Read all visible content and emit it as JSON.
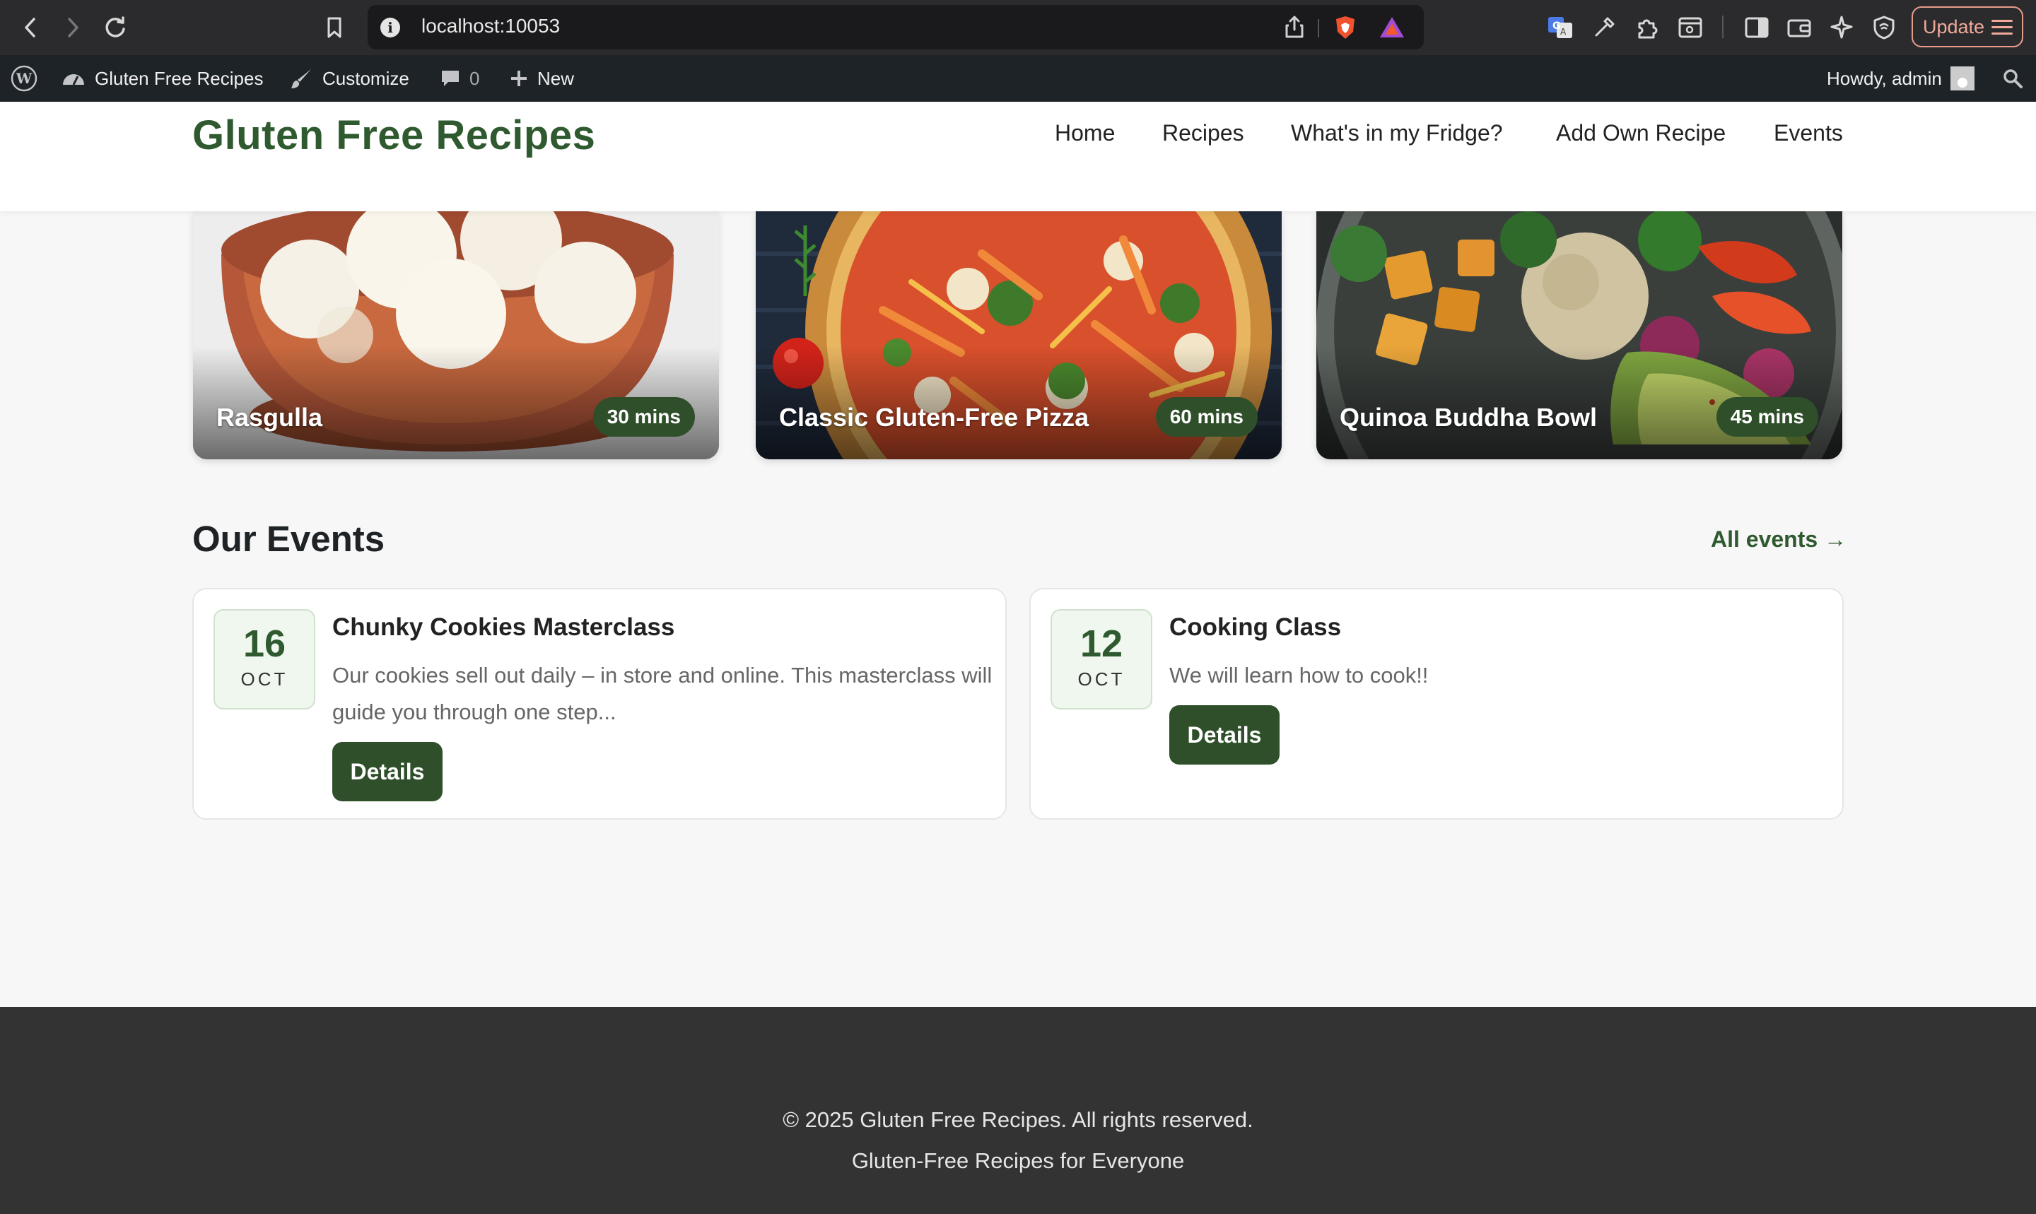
{
  "browser": {
    "url": "localhost:10053",
    "update_label": "Update"
  },
  "adminbar": {
    "site_name": "Gluten Free Recipes",
    "customize": "Customize",
    "comments_count": "0",
    "new_label": "New",
    "howdy": "Howdy, admin"
  },
  "site": {
    "title": "Gluten Free Recipes",
    "nav": [
      "Home",
      "Recipes",
      "What's in my Fridge?",
      "Add Own Recipe",
      "Events"
    ]
  },
  "recipes": [
    {
      "name": "Rasgulla",
      "time": "30 mins"
    },
    {
      "name": "Classic Gluten-Free Pizza",
      "time": "60 mins"
    },
    {
      "name": "Quinoa Buddha Bowl",
      "time": "45 mins"
    }
  ],
  "events_section": {
    "heading": "Our Events",
    "all_events_label": "All events →",
    "events": [
      {
        "day": "16",
        "month": "OCT",
        "title": "Chunky Cookies Masterclass",
        "description": "Our cookies sell out daily – in store and online. This masterclass will guide you through one step...",
        "button": "Details"
      },
      {
        "day": "12",
        "month": "OCT",
        "title": "Cooking Class",
        "description": "We will learn how to cook!!",
        "button": "Details"
      }
    ]
  },
  "footer": {
    "copyright": "© 2025 Gluten Free Recipes. All rights reserved.",
    "tagline": "Gluten-Free Recipes for Everyone"
  },
  "colors": {
    "brand_green": "#2f5a2f",
    "badge_green": "#2f4f2a",
    "footer_bg": "#333333",
    "adminbar_bg": "#1d2327"
  }
}
